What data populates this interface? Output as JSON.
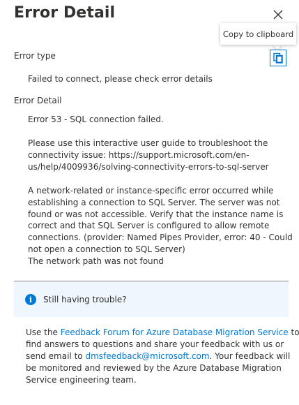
{
  "panel": {
    "title": "Error Detail",
    "tooltip": "Copy to clipboard"
  },
  "error_type": {
    "label": "Error type",
    "value": "Failed to connect, please check error details"
  },
  "error_detail": {
    "label": "Error Detail",
    "paragraphs": [
      [
        "Error 53 - SQL connection failed."
      ],
      [
        "Please use this interactive user guide to troubleshoot the",
        "connectivity issue:  https://support.microsoft.com/en-",
        "us/help/4009936/solving-connectivity-errors-to-sql-server"
      ],
      [
        "A network-related or instance-specific error occurred while",
        "establishing a connection to SQL Server. The server was not",
        "found or was not accessible. Verify that the instance name is",
        "correct and that SQL Server is configured to allow remote",
        "connections. (provider: Named Pipes Provider, error: 40 - Could",
        "not open a connection to SQL Server)",
        "The network path was not found"
      ]
    ]
  },
  "help": {
    "text": "Still having trouble?"
  },
  "feedback": {
    "use_the": "Use the ",
    "forum_link": "Feedback Forum for Azure Database Migration Service",
    "after_forum": " to",
    "line2": "find answers to questions and share your feedback with us or",
    "send_email": "send email to ",
    "email_link": "dmsfeedback@microsoft.com",
    "after_email": ". Your feedback will",
    "line4": "be monitored and reviewed by the Azure Database Migration",
    "line5": "Service engineering team."
  },
  "colors": {
    "accent": "#0078d4",
    "help_bg": "#f0f6fd",
    "text": "#323130"
  }
}
